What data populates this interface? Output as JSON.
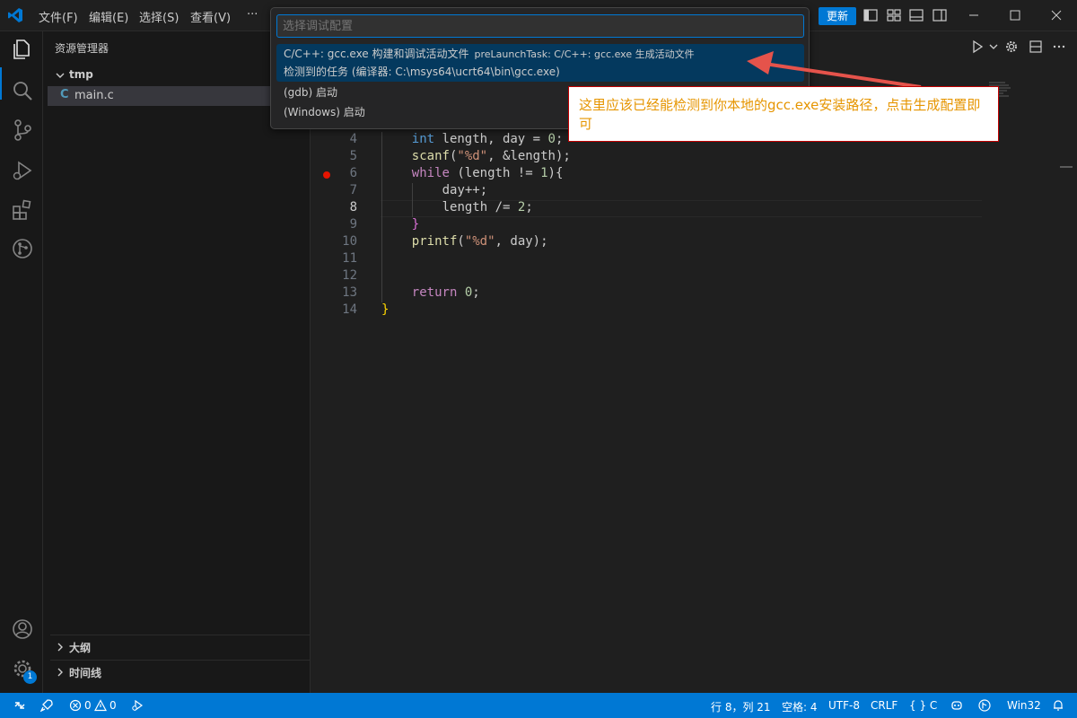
{
  "titlebar": {
    "menu": [
      "文件(F)",
      "编辑(E)",
      "选择(S)",
      "查看(V)",
      "···"
    ],
    "update_label": "更新"
  },
  "sidebar": {
    "title": "资源管理器",
    "folder": "tmp",
    "file": "main.c",
    "file_icon": "C",
    "sections": [
      "大纲",
      "时间线"
    ]
  },
  "activitybar": {
    "settings_badge": "1"
  },
  "editor": {
    "lines": [
      {
        "n": "4",
        "tokens": [
          [
            "kw",
            "int"
          ],
          [
            "plain",
            " length, day = "
          ],
          [
            "num",
            "0"
          ],
          [
            "plain",
            ";"
          ]
        ]
      },
      {
        "n": "5",
        "tokens": [
          [
            "fn",
            "scanf"
          ],
          [
            "plain",
            "("
          ],
          [
            "str",
            "\"%d\""
          ],
          [
            "plain",
            ", &length);"
          ]
        ]
      },
      {
        "n": "6",
        "tokens": [
          [
            "kw2",
            "while"
          ],
          [
            "plain",
            " (length != "
          ],
          [
            "num",
            "1"
          ],
          [
            "plain",
            "){"
          ]
        ]
      },
      {
        "n": "7",
        "tokens": [
          [
            "plain",
            "day++;"
          ]
        ]
      },
      {
        "n": "8",
        "tokens": [
          [
            "plain",
            "length /= "
          ],
          [
            "num",
            "2"
          ],
          [
            "plain",
            ";"
          ]
        ]
      },
      {
        "n": "9",
        "tokens": [
          [
            "brace-p",
            "}"
          ]
        ]
      },
      {
        "n": "10",
        "tokens": [
          [
            "fn",
            "printf"
          ],
          [
            "plain",
            "("
          ],
          [
            "str",
            "\"%d\""
          ],
          [
            "plain",
            ", day);"
          ]
        ]
      },
      {
        "n": "11",
        "tokens": []
      },
      {
        "n": "12",
        "tokens": []
      },
      {
        "n": "13",
        "tokens": [
          [
            "kw2",
            "return"
          ],
          [
            "plain",
            " "
          ],
          [
            "num",
            "0"
          ],
          [
            "plain",
            ";"
          ]
        ]
      },
      {
        "n": "14",
        "tokens": [
          [
            "brace-y",
            "}"
          ]
        ]
      }
    ],
    "breakpoint_line": "6",
    "current_line": "8"
  },
  "quickpick": {
    "placeholder": "选择调试配置",
    "items": [
      {
        "label": "C/C++: gcc.exe 构建和调试活动文件",
        "desc": "preLaunchTask: C/C++: gcc.exe 生成活动文件",
        "detail": "检测到的任务 (编译器: C:\\msys64\\ucrt64\\bin\\gcc.exe)"
      },
      {
        "label": "(gdb) 启动"
      },
      {
        "label": "(Windows) 启动"
      }
    ]
  },
  "annotation": {
    "text": "这里应该已经能检测到你本地的gcc.exe安装路径，点击生成配置即可"
  },
  "statusbar": {
    "errors": "0",
    "warnings": "0",
    "position": "行 8，列 21",
    "spaces": "空格: 4",
    "encoding": "UTF-8",
    "eol": "CRLF",
    "language": "{ } C",
    "platform": "Win32"
  },
  "colors": {
    "accent": "#0078d4",
    "annotation_text": "#e69500",
    "annotation_border": "#c00000",
    "breakpoint": "#e51400"
  }
}
